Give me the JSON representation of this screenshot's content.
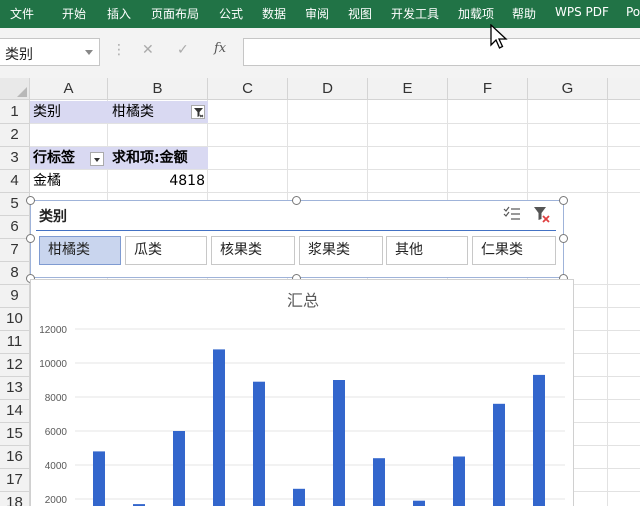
{
  "ribbon": {
    "tabs": [
      "文件",
      "开始",
      "插入",
      "页面布局",
      "公式",
      "数据",
      "审阅",
      "视图",
      "开发工具",
      "加载项",
      "帮助",
      "WPS PDF",
      "Po"
    ]
  },
  "formula_bar": {
    "name_box": "类别",
    "fx": "fx",
    "content": ""
  },
  "columns": [
    "A",
    "B",
    "C",
    "D",
    "E",
    "F",
    "G"
  ],
  "rows": [
    "1",
    "2",
    "3",
    "4",
    "5",
    "6",
    "7",
    "8",
    "9",
    "10",
    "11",
    "12",
    "13",
    "14",
    "15",
    "16",
    "17",
    "18"
  ],
  "cells": {
    "a1": "类别",
    "b1": "柑橘类",
    "a3": "行标签",
    "b3": "求和项:金额",
    "a4": "金橘",
    "b4": "4818"
  },
  "slicer": {
    "title": "类别",
    "items": [
      "柑橘类",
      "瓜类",
      "核果类",
      "浆果类",
      "其他",
      "仁果类"
    ],
    "selected": "柑橘类"
  },
  "chart_data": {
    "type": "bar",
    "title": "汇总",
    "y_ticks": [
      "12000",
      "10000",
      "8000",
      "6000",
      "4000",
      "2000"
    ],
    "values": [
      4800,
      1700,
      6000,
      10800,
      8900,
      2600,
      9000,
      4400,
      1900,
      4500,
      7600,
      9300
    ],
    "ylim": [
      0,
      12000
    ],
    "bar_color": "#3366cc",
    "grid": true
  },
  "colors": {
    "ribbon": "#217346",
    "pivot_header": "#d9d9f2",
    "slicer_selected": "#c9d5ee"
  }
}
